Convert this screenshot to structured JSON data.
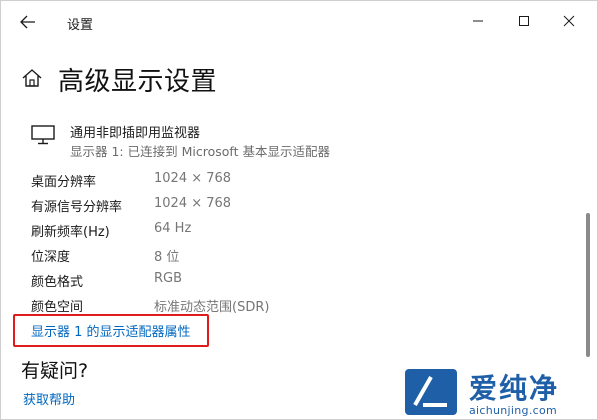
{
  "window": {
    "app_title": "设置"
  },
  "header": {
    "title": "高级显示设置"
  },
  "monitor": {
    "name": "通用非即插即用监视器",
    "description": "显示器 1: 已连接到 Microsoft 基本显示适配器"
  },
  "details": [
    {
      "label": "桌面分辨率",
      "value": "1024 × 768"
    },
    {
      "label": "有源信号分辨率",
      "value": "1024 × 768"
    },
    {
      "label": "刷新频率(Hz)",
      "value": "64 Hz"
    },
    {
      "label": "位深度",
      "value": "8 位"
    },
    {
      "label": "颜色格式",
      "value": "RGB"
    },
    {
      "label": "颜色空间",
      "value": "标准动态范围(SDR)"
    }
  ],
  "links": {
    "adapter_properties": "显示器 1 的显示适配器属性",
    "get_help": "获取帮助"
  },
  "help_section": {
    "title": "有疑问?"
  },
  "watermark": {
    "cn": "爱纯净",
    "en": "aichunjing.com"
  },
  "colors": {
    "link": "#0067c0",
    "highlight": "#e11b1b",
    "watermark": "#1f5fa8"
  }
}
